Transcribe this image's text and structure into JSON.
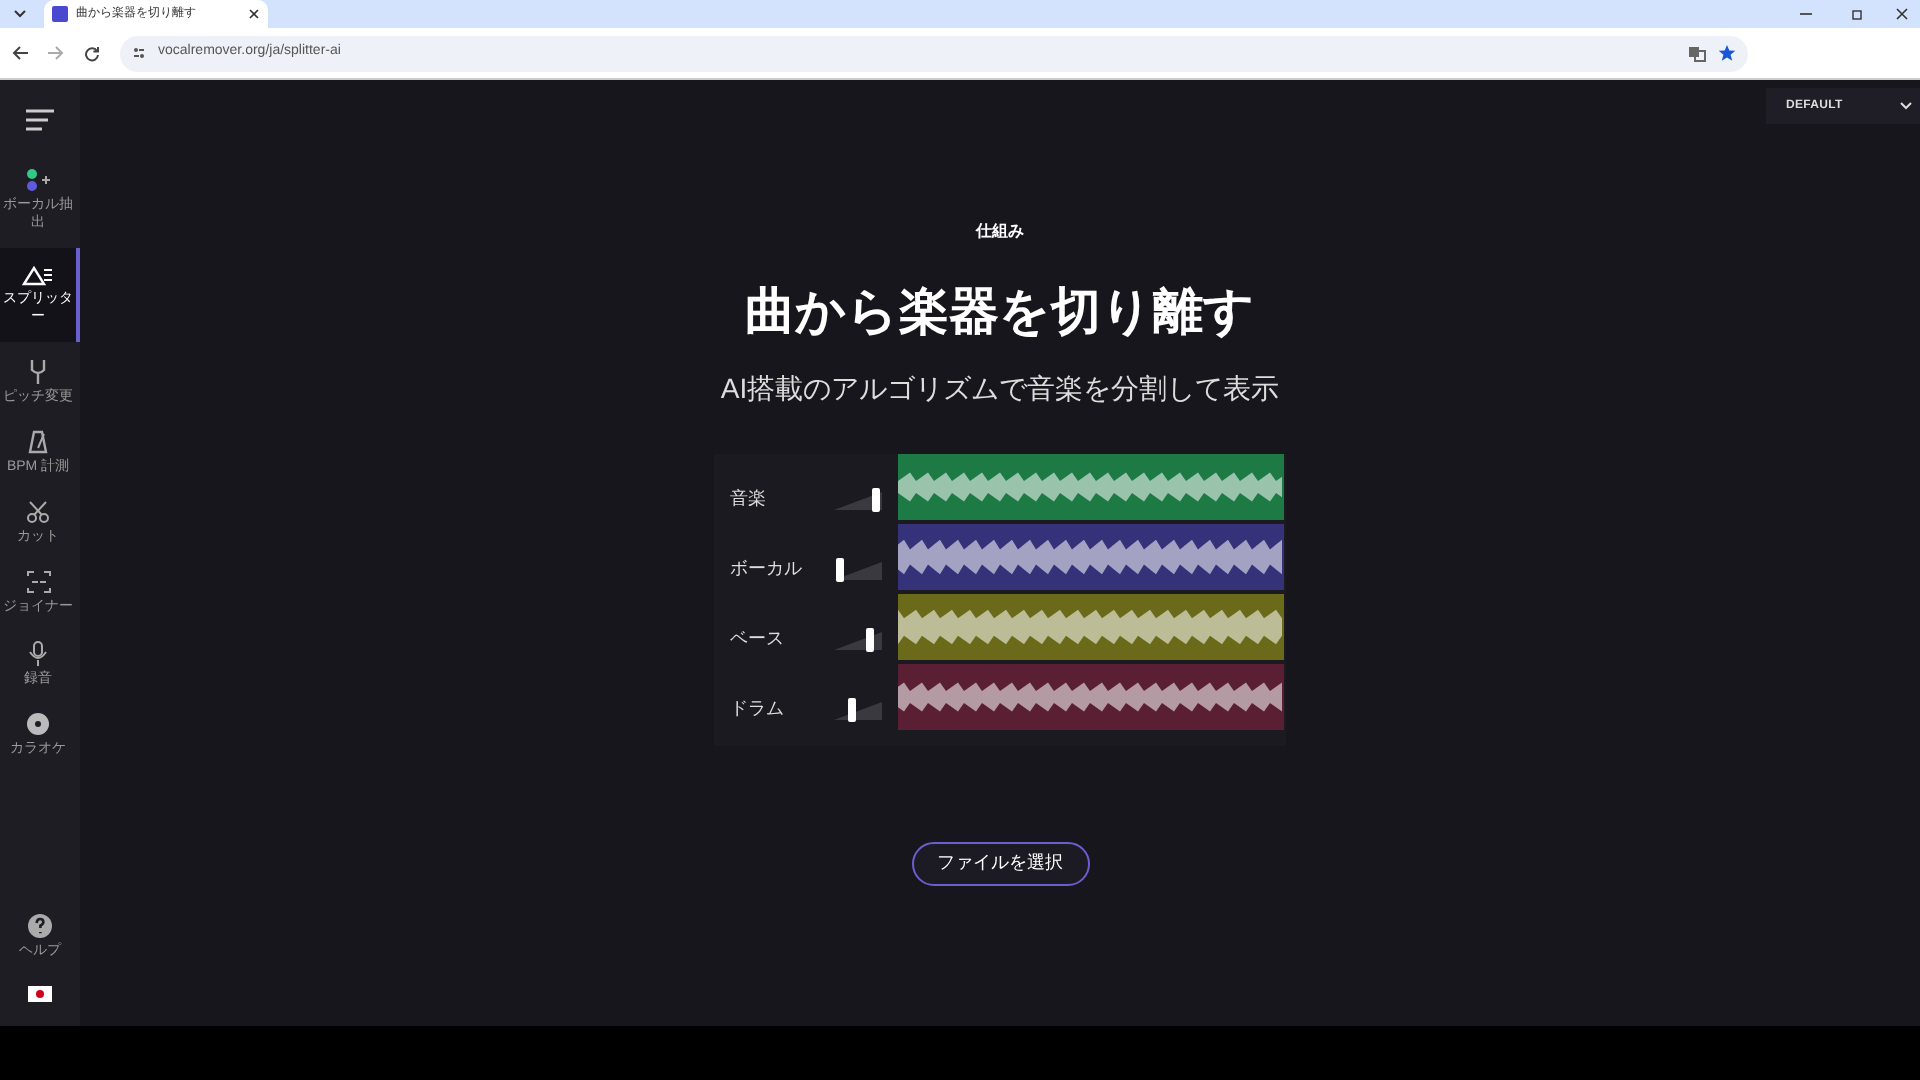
{
  "browser": {
    "tab_title": "曲から楽器を切り離す",
    "url": "vocalremover.org/ja/splitter-ai"
  },
  "mode_dropdown": {
    "value": "DEFAULT"
  },
  "sidebar": {
    "items": [
      {
        "label": "ボーカル抽出",
        "kind": "dots",
        "selected": false
      },
      {
        "label": "スプリッター",
        "kind": "split",
        "selected": true
      },
      {
        "label": "ピッチ変更",
        "kind": "fork",
        "selected": false
      },
      {
        "label": "BPM 計測",
        "kind": "metronome",
        "selected": false
      },
      {
        "label": "カット",
        "kind": "scissors",
        "selected": false
      },
      {
        "label": "ジョイナー",
        "kind": "join",
        "selected": false
      },
      {
        "label": "録音",
        "kind": "mic",
        "selected": false
      },
      {
        "label": "カラオケ",
        "kind": "disc",
        "selected": false
      }
    ],
    "help": {
      "label": "ヘルプ"
    }
  },
  "hero": {
    "eyebrow": "仕組み",
    "title": "曲から楽器を切り離す",
    "subtitle": "AI搭載のアルゴリズムで音楽を分割して表示"
  },
  "tracks": [
    {
      "label": "音楽",
      "level": 0.95,
      "color": "#1e7a45"
    },
    {
      "label": "ボーカル",
      "level": 0.05,
      "color": "#35327a"
    },
    {
      "label": "ベース",
      "level": 0.8,
      "color": "#6b6a1a"
    },
    {
      "label": "ドラム",
      "level": 0.35,
      "color": "#5a1f33"
    }
  ],
  "file_button": {
    "label": "ファイルを選択"
  }
}
